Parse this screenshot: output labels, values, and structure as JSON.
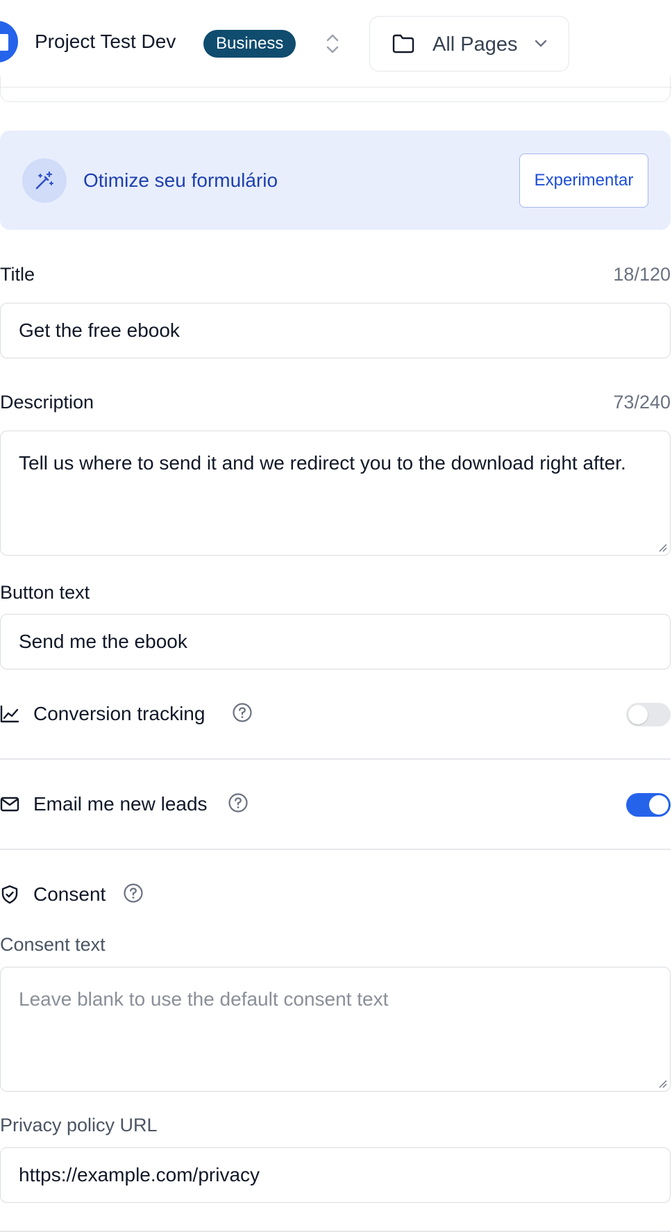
{
  "header": {
    "project_name": "Project Test Dev",
    "plan_badge": "Business",
    "pages_selector": "All Pages"
  },
  "promo": {
    "text": "Otimize seu formulário",
    "button": "Experimentar"
  },
  "form": {
    "title": {
      "label": "Title",
      "counter": "18/120",
      "value": "Get the free ebook"
    },
    "description": {
      "label": "Description",
      "counter": "73/240",
      "value": "Tell us where to send it and we redirect you to the download right after."
    },
    "button_text": {
      "label": "Button text",
      "value": "Send me the ebook"
    },
    "conversion_tracking": {
      "label": "Conversion tracking",
      "enabled": false
    },
    "email_leads": {
      "label": "Email me new leads",
      "enabled": true
    },
    "consent": {
      "label": "Consent",
      "consent_text_label": "Consent text",
      "consent_text_placeholder": "Leave blank to use the default consent text",
      "privacy_label": "Privacy policy URL",
      "privacy_value": "https://example.com/privacy"
    }
  },
  "colors": {
    "accent": "#2563eb",
    "badge": "#0f4c6e",
    "promo_bg": "#e8eefc"
  }
}
